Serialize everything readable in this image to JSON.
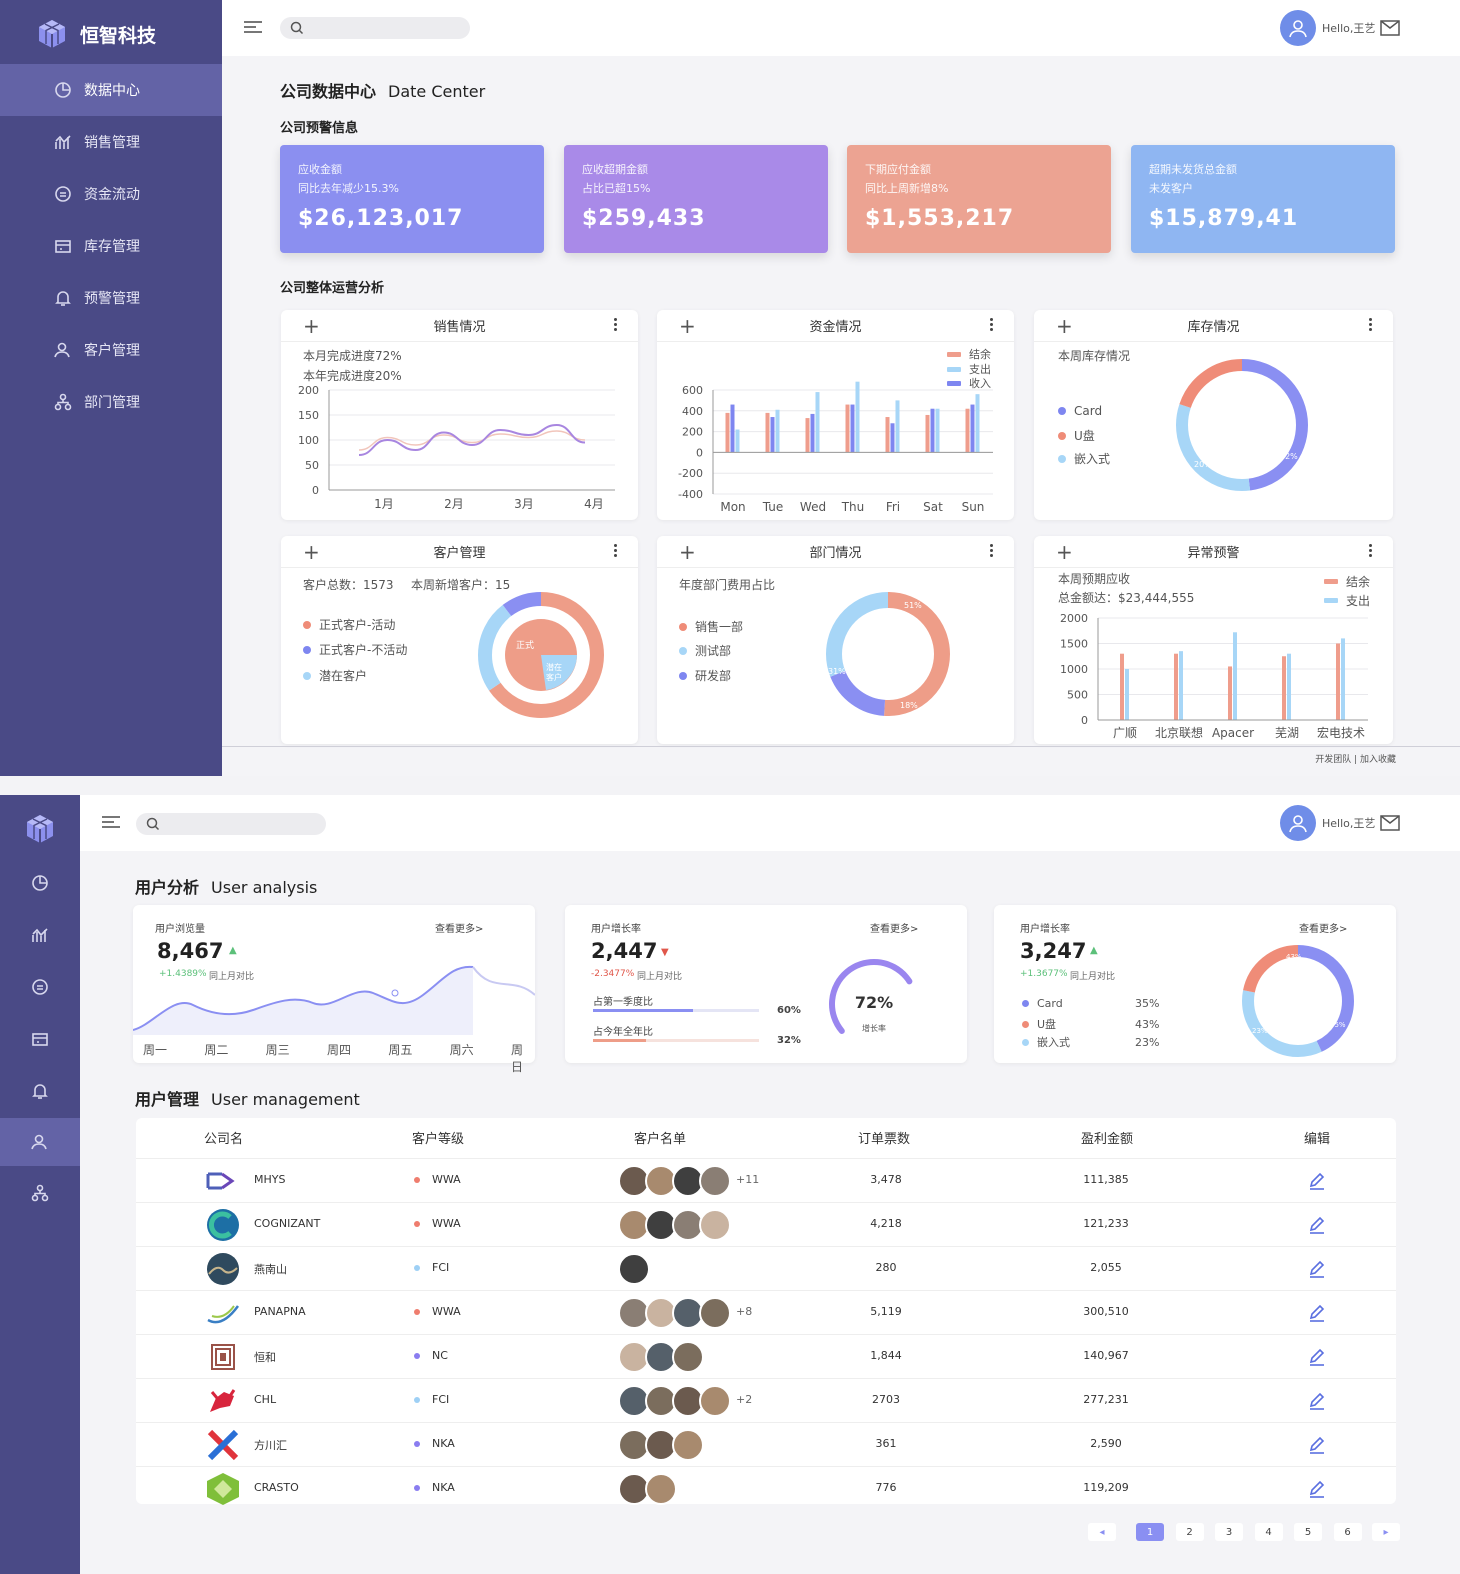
{
  "brand": {
    "name": "恒智科技"
  },
  "sidebar": {
    "items": [
      {
        "label": "数据中心",
        "icon": "pie-chart-icon",
        "active": true
      },
      {
        "label": "销售管理",
        "icon": "trend-icon"
      },
      {
        "label": "资金流动",
        "icon": "money-icon"
      },
      {
        "label": "库存管理",
        "icon": "inventory-icon"
      },
      {
        "label": "预警管理",
        "icon": "bell-icon"
      },
      {
        "label": "客户管理",
        "icon": "users-icon"
      },
      {
        "label": "部门管理",
        "icon": "org-icon"
      }
    ]
  },
  "header": {
    "user": "Hello,王艺"
  },
  "page1": {
    "title": "公司数据中心",
    "title_en": "Date Center",
    "section_warning": "公司预警信息",
    "section_analysis": "公司整体运营分析",
    "kpis": [
      {
        "l1": "应收金额",
        "l2": "同比去年减少15.3%",
        "value": "$26,123,017",
        "color": "#8b8ff0"
      },
      {
        "l1": "应收超期金额",
        "l2": "占比已超15%",
        "value": "$259,433",
        "color": "#a98ae8"
      },
      {
        "l1": "下期应付金额",
        "l2": "同比上周新增8%",
        "value": "$1,553,217",
        "color": "#eca392"
      },
      {
        "l1": "超期未发货总金额",
        "l2": "未发客户",
        "value": "$15,879,41",
        "color": "#8fb6f2"
      }
    ],
    "cards": {
      "sales": {
        "title": "销售情况",
        "line1": "本月完成进度72%",
        "line2": "本年完成进度20%"
      },
      "funds": {
        "title": "资金情况",
        "legend": [
          "结余",
          "支出",
          "收入"
        ]
      },
      "stock": {
        "title": "库存情况",
        "subtitle": "本周库存情况",
        "legend": [
          "Card",
          "U盘",
          "嵌入式"
        ],
        "labels": [
          "48%",
          "20%",
          "32%"
        ]
      },
      "customer": {
        "title": "客户管理",
        "total": "客户总数：1573",
        "new": "本周新增客户：15",
        "legend": [
          "正式客户-活动",
          "正式客户-不活动",
          "潜在客户"
        ],
        "inner1": "正式",
        "inner2": "潜在",
        "inner3": "客户"
      },
      "dept": {
        "title": "部门情况",
        "subtitle": "年度部门费用占比",
        "legend": [
          "销售一部",
          "测试部",
          "研发部"
        ],
        "labels": [
          "51%",
          "31%",
          "18%"
        ]
      },
      "alert": {
        "title": "异常预警",
        "line1": "本周预期应收",
        "line2": "总金额达：$23,444,555",
        "legend": [
          "结余",
          "支出"
        ]
      }
    },
    "footer": "开发团队 | 加入收藏"
  },
  "page2": {
    "title": "用户分析",
    "title_en": "User analysis",
    "cards": [
      {
        "label": "用户浏览量",
        "more": "查看更多>",
        "value": "8,467",
        "pct": "+1.4389%",
        "cmp": "同上月对比",
        "trend": "up"
      },
      {
        "label": "用户增长率",
        "more": "查看更多>",
        "value": "2,447",
        "pct": "-2.3477%",
        "cmp": "同上月对比",
        "trend": "down",
        "bar1": "占第一季度比",
        "bar1v": "60%",
        "bar1f": 0.6,
        "bar2": "占今年全年比",
        "bar2v": "32%",
        "bar2f": 0.32,
        "gauge": "72%",
        "gauge_f": 0.72,
        "gauge_lbl": "增长率"
      },
      {
        "label": "用户增长率",
        "more": "查看更多>",
        "value": "3,247",
        "pct": "+1.3677%",
        "cmp": "同上月对比",
        "trend": "up",
        "legend": [
          {
            "n": "Card",
            "v": "35%"
          },
          {
            "n": "U盘",
            "v": "43%"
          },
          {
            "n": "嵌入式",
            "v": "23%"
          }
        ],
        "labels": [
          "43%",
          "23%",
          "35%"
        ]
      }
    ],
    "days": [
      "周一",
      "周二",
      "周三",
      "周四",
      "周五",
      "周六",
      "周日"
    ],
    "mgmt_title": "用户管理",
    "mgmt_title_en": "User management",
    "columns": [
      "公司名",
      "客户等级",
      "客户名单",
      "订单票数",
      "盈利金额",
      "编辑"
    ],
    "rows": [
      {
        "company": "MHYS",
        "level": "WWA",
        "lc": "#ef7d6e",
        "av": 4,
        "extra": "+11",
        "orders": "3,478",
        "profit": "111,385"
      },
      {
        "company": "COGNIZANT",
        "level": "WWA",
        "lc": "#ef7d6e",
        "av": 4,
        "extra": "",
        "orders": "4,218",
        "profit": "121,233"
      },
      {
        "company": "燕南山",
        "level": "FCI",
        "lc": "#9ed0f5",
        "av": 1,
        "extra": "",
        "orders": "280",
        "profit": "2,055"
      },
      {
        "company": "PANAPNA",
        "level": "WWA",
        "lc": "#ef7d6e",
        "av": 4,
        "extra": "+8",
        "orders": "5,119",
        "profit": "300,510"
      },
      {
        "company": "恒和",
        "level": "NC",
        "lc": "#8a7df0",
        "av": 3,
        "extra": "",
        "orders": "1,844",
        "profit": "140,967"
      },
      {
        "company": "CHL",
        "level": "FCI",
        "lc": "#9ed0f5",
        "av": 4,
        "extra": "+2",
        "orders": "2703",
        "profit": "277,231"
      },
      {
        "company": "方川汇",
        "level": "NKA",
        "lc": "#8a7df0",
        "av": 3,
        "extra": "",
        "orders": "361",
        "profit": "2,590"
      },
      {
        "company": "CRASTO",
        "level": "NKA",
        "lc": "#8a7df0",
        "av": 2,
        "extra": "",
        "orders": "776",
        "profit": "119,209"
      }
    ],
    "pages": [
      "1",
      "2",
      "3",
      "4",
      "5",
      "6"
    ]
  },
  "chart_data": [
    {
      "type": "line",
      "title": "销售情况",
      "categories": [
        "1月",
        "2月",
        "3月",
        "4月"
      ],
      "ylim": [
        0,
        200
      ],
      "yticks": [
        0,
        50,
        100,
        150,
        200
      ],
      "series": [
        {
          "values": [
            70,
            100,
            80,
            115,
            90,
            120,
            110,
            130,
            95
          ]
        },
        {
          "values": [
            80,
            105,
            90,
            110,
            95,
            112,
            105,
            118,
            100
          ]
        }
      ]
    },
    {
      "type": "bar",
      "title": "资金情况",
      "categories": [
        "Mon",
        "Tue",
        "Wed",
        "Thu",
        "Fri",
        "Sat",
        "Sun"
      ],
      "ylim": [
        -400,
        600
      ],
      "yticks": [
        600,
        400,
        200,
        0,
        -200,
        -400
      ],
      "series": [
        {
          "name": "结余",
          "values": [
            380,
            380,
            330,
            460,
            340,
            360,
            420
          ]
        },
        {
          "name": "收入",
          "values": [
            460,
            340,
            370,
            460,
            280,
            420,
            460
          ]
        },
        {
          "name": "支出",
          "values": [
            220,
            410,
            580,
            680,
            500,
            420,
            560
          ]
        }
      ]
    },
    {
      "type": "bar",
      "title": "异常预警",
      "categories": [
        "广顺",
        "北京联想",
        "Apacer",
        "芜湖",
        "宏电技术"
      ],
      "ylim": [
        0,
        2000
      ],
      "yticks": [
        2000,
        1500,
        1000,
        500,
        0
      ],
      "series": [
        {
          "name": "结余",
          "values": [
            1300,
            1300,
            1050,
            1250,
            1500
          ]
        },
        {
          "name": "支出",
          "values": [
            1000,
            1350,
            1720,
            1300,
            1600
          ]
        }
      ]
    }
  ]
}
